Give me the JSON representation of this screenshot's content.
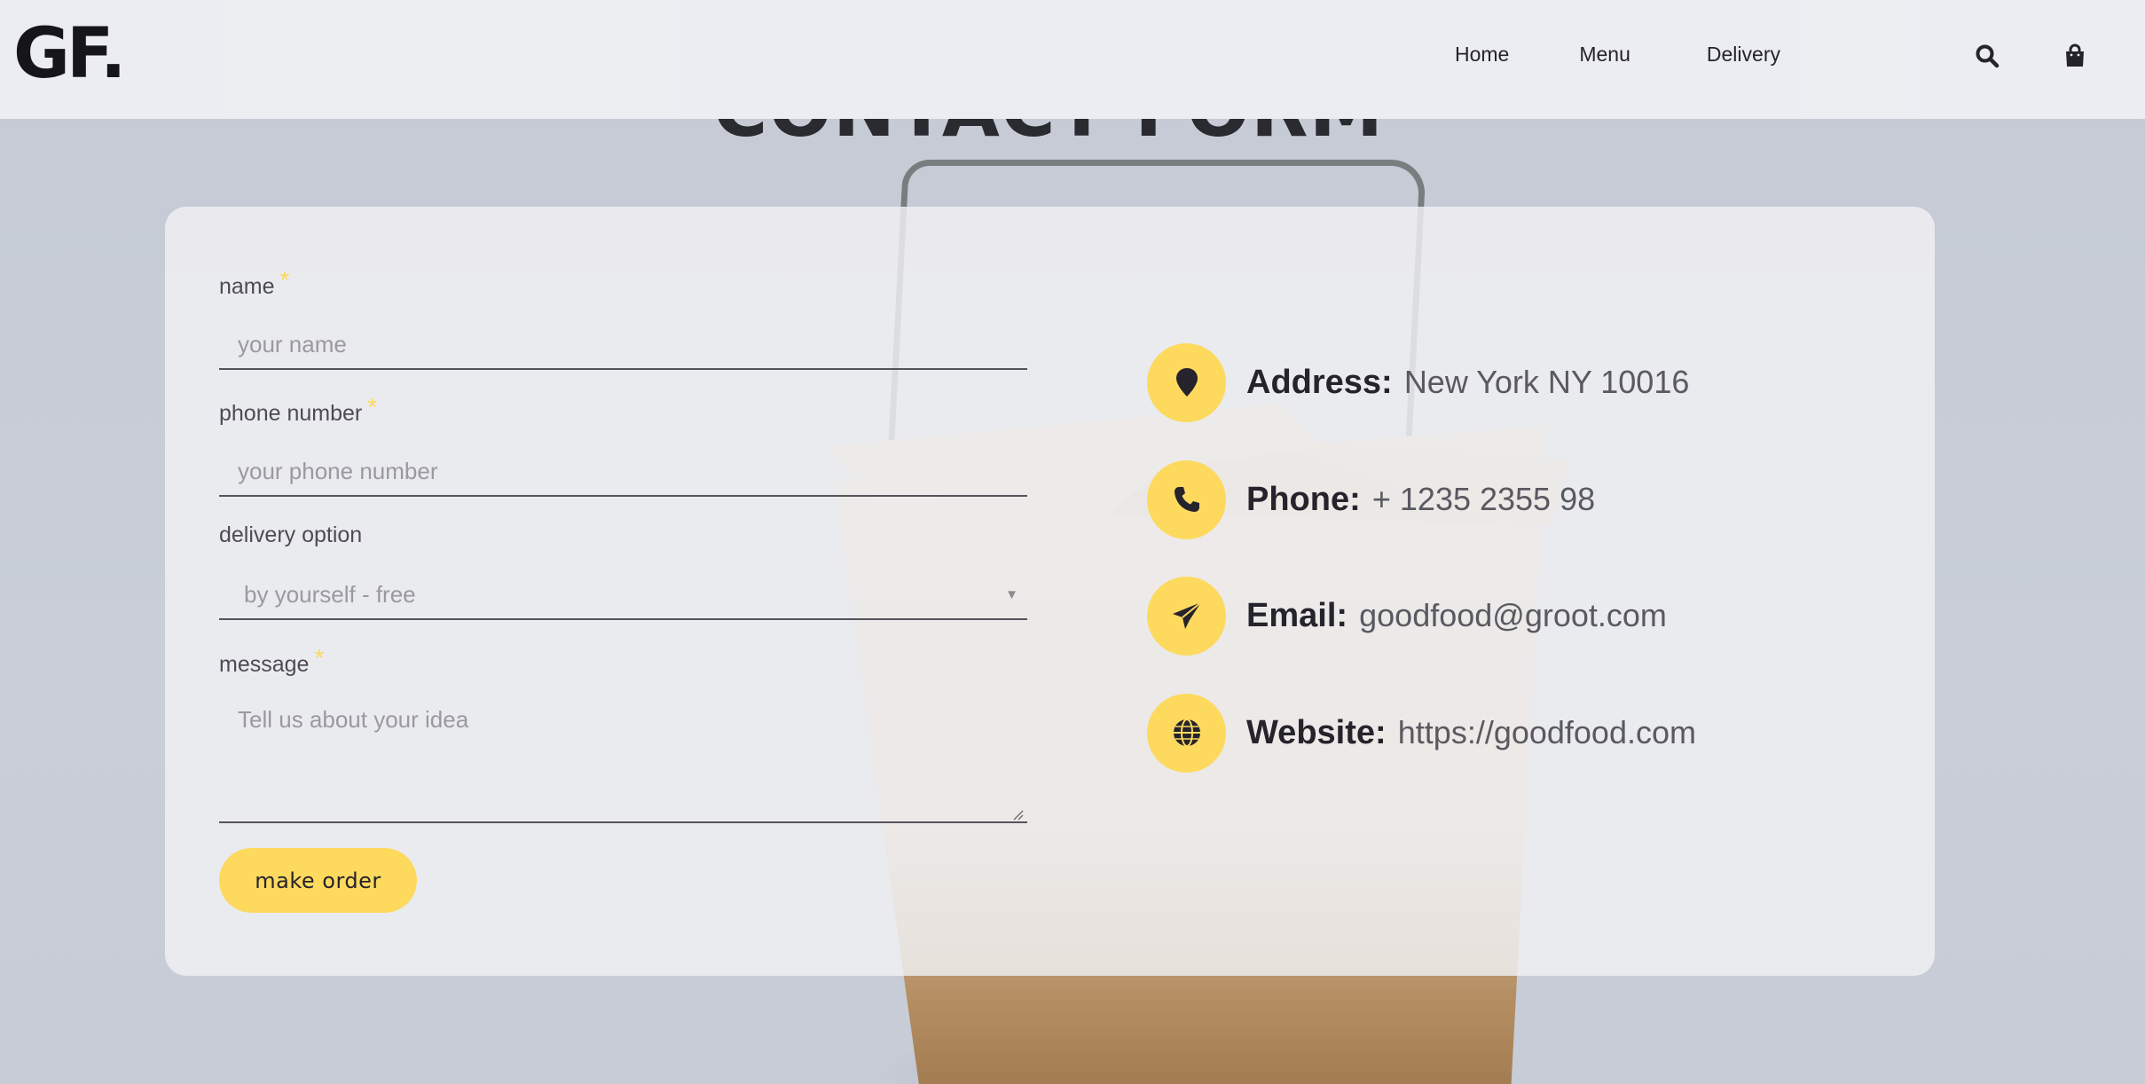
{
  "header": {
    "logo": "GF.",
    "nav": [
      {
        "label": "Home"
      },
      {
        "label": "Menu"
      },
      {
        "label": "Delivery"
      }
    ],
    "icons": [
      "search-icon",
      "shopping-bag-icon"
    ]
  },
  "page": {
    "title": "CONTACT FORM"
  },
  "form": {
    "name": {
      "label": "name",
      "required_mark": "*",
      "placeholder": "your name",
      "value": ""
    },
    "phone": {
      "label": "phone number",
      "required_mark": "*",
      "placeholder": "your phone number",
      "value": ""
    },
    "delivery": {
      "label": "delivery option",
      "selected": "by yourself - free",
      "caret": "▼"
    },
    "message": {
      "label": "message",
      "required_mark": "*",
      "placeholder": "Tell us about your idea",
      "value": ""
    },
    "submit_label": "make order"
  },
  "contact": [
    {
      "icon": "map-pin-icon",
      "key": "Address:",
      "value": "New York NY 10016"
    },
    {
      "icon": "phone-icon",
      "key": "Phone:",
      "value": "+ 1235 2355 98"
    },
    {
      "icon": "paper-plane-icon",
      "key": "Email:",
      "value": "goodfood@groot.com"
    },
    {
      "icon": "globe-icon",
      "key": "Website:",
      "value": "https://goodfood.com"
    }
  ],
  "colors": {
    "accent": "#fdd95e",
    "text": "#25232b",
    "header_bg": "#ebedf1",
    "card_bg": "#f0f1f3"
  }
}
